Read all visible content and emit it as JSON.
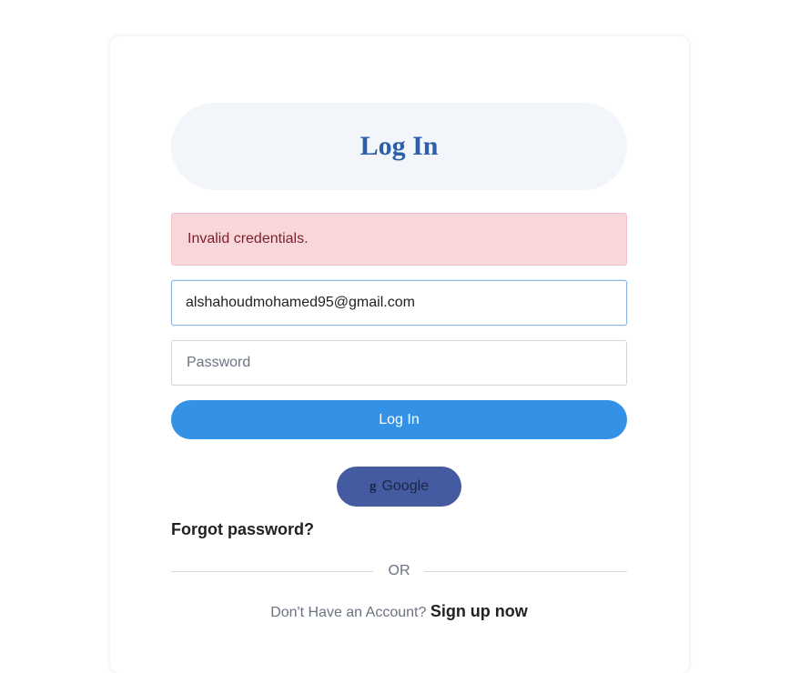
{
  "login": {
    "title": "Log In",
    "error": "Invalid credentials.",
    "email_value": "alshahoudmohamed95@gmail.com",
    "password_placeholder": "Password",
    "submit_label": "Log In",
    "google_label": "Google",
    "google_icon": "g",
    "forgot_label": "Forgot password?",
    "divider_label": "OR",
    "no_account_text": "Don't Have an Account?",
    "signup_label": "Sign up now"
  },
  "colors": {
    "title": "#2e5ea8",
    "title_bg": "#f2f5fa",
    "alert_bg": "#f7d7da",
    "alert_text": "#7d1f2a",
    "primary_button": "#3391e6",
    "google_button": "#445aa1"
  }
}
